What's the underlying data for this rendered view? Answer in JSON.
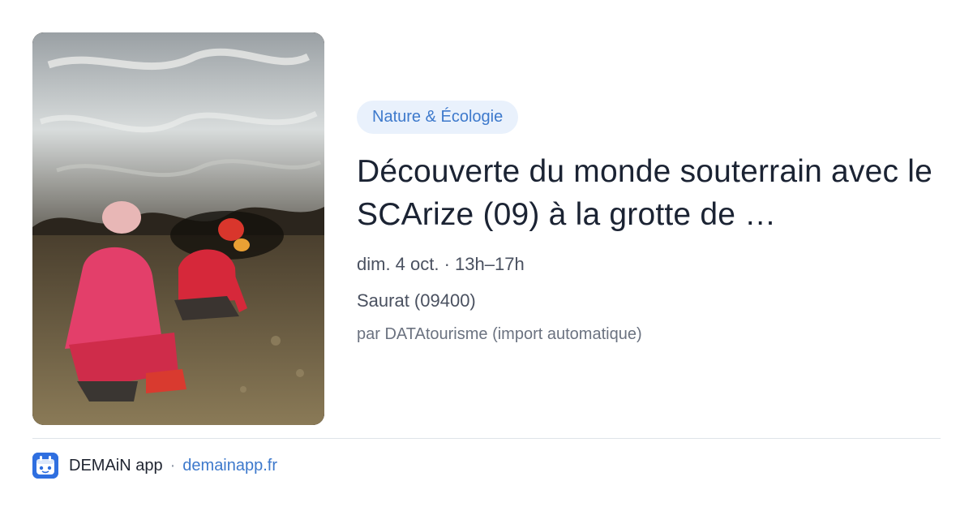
{
  "card": {
    "image_alt": "cave-exploration-photo",
    "tag": "Nature & Écologie",
    "title": "Découverte du monde souterrain avec le SCArize (09) à la grotte de …",
    "when": "dim. 4 oct. · 13h–17h",
    "where": "Saurat (09400)",
    "by": "par DATAtourisme (import automatique)"
  },
  "footer": {
    "app_icon": "demain-app-icon",
    "app_name": "DEMAiN app",
    "separator": "·",
    "link": "demainapp.fr"
  },
  "colors": {
    "accent": "#3d79cc",
    "tag_bg": "#e9f1fc",
    "title": "#1b2333",
    "muted": "#6b7280"
  }
}
